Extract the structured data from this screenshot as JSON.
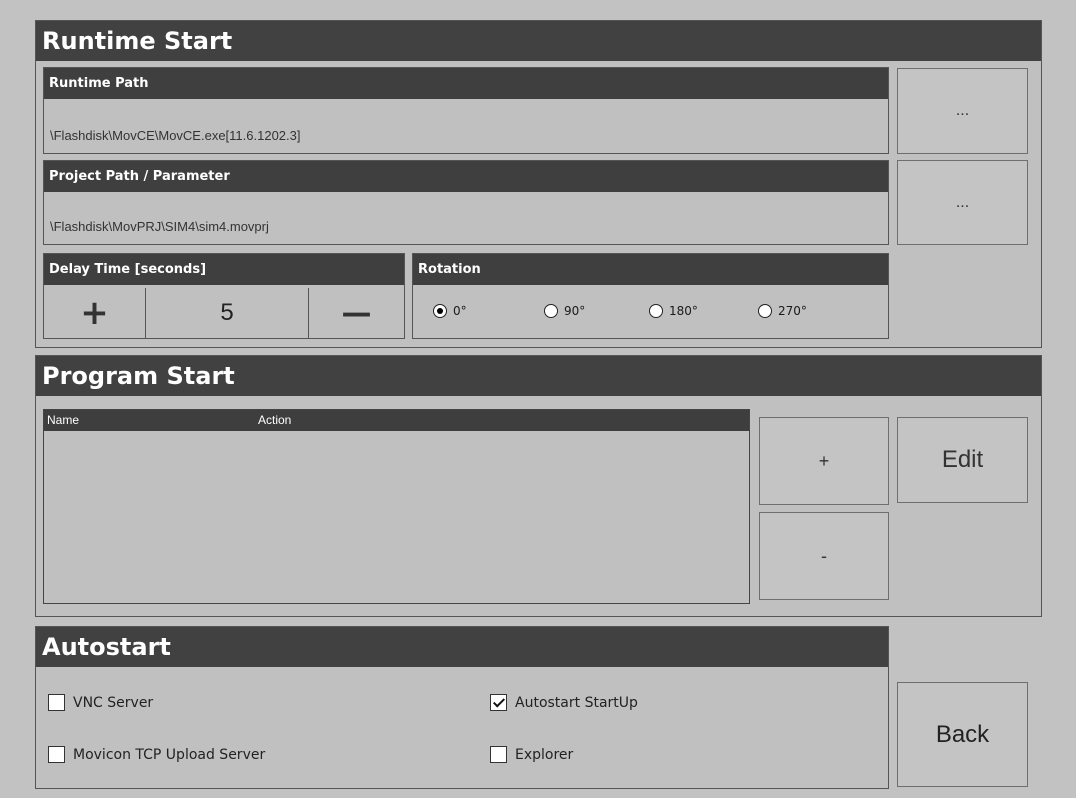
{
  "runtime_start": {
    "title": "Runtime Start",
    "runtime_path": {
      "label": "Runtime Path",
      "value": "\\Flashdisk\\MovCE\\MovCE.exe[11.6.1202.3]",
      "browse_label": "..."
    },
    "project_path": {
      "label": "Project Path / Parameter",
      "value": "\\Flashdisk\\MovPRJ\\SIM4\\sim4.movprj",
      "browse_label": "..."
    },
    "delay": {
      "label": "Delay Time [seconds]",
      "value": "5",
      "increase_label": "+",
      "decrease_label": "—"
    },
    "rotation": {
      "label": "Rotation",
      "options": [
        "0°",
        "90°",
        "180°",
        "270°"
      ],
      "selected": "0°"
    }
  },
  "program_start": {
    "title": "Program Start",
    "columns": [
      "Name",
      "Action"
    ],
    "rows": [],
    "add_label": "+",
    "remove_label": "-",
    "edit_label": "Edit"
  },
  "autostart": {
    "title": "Autostart",
    "options": [
      {
        "label": "VNC Server",
        "checked": false
      },
      {
        "label": "Autostart StartUp",
        "checked": true
      },
      {
        "label": "Movicon TCP Upload Server",
        "checked": false
      },
      {
        "label": "Explorer",
        "checked": false
      }
    ]
  },
  "back_label": "Back"
}
